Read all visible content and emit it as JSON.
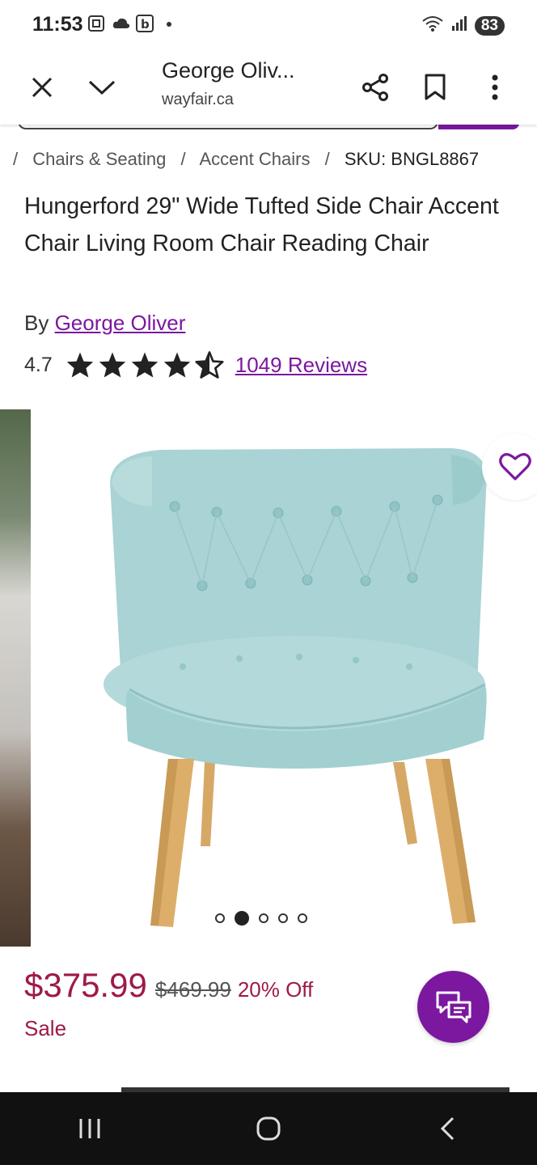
{
  "status_bar": {
    "time": "11:53",
    "battery": "83",
    "icons": [
      "screenshot-icon",
      "cloud-icon",
      "b-app-icon",
      "dot-icon",
      "wifi-icon",
      "signal-icon",
      "battery-icon"
    ]
  },
  "browser": {
    "title": "George Oliv...",
    "url": "wayfair.ca",
    "close_icon": "close-icon",
    "minimize_icon": "chevron-down-icon",
    "share_icon": "share-icon",
    "bookmark_icon": "bookmark-icon",
    "menu_icon": "more-vertical-icon"
  },
  "breadcrumb": {
    "items": [
      "Chairs & Seating",
      "Accent Chairs"
    ],
    "separator": "/",
    "sku": "SKU: BNGL8867"
  },
  "product": {
    "title": "Hungerford 29\" Wide Tufted Side Chair Accent Chair Living Room Chair Reading Chair",
    "by_prefix": "By",
    "brand": "George Oliver",
    "rating": "4.7",
    "rating_value": 4.7,
    "reviews": "1049 Reviews"
  },
  "carousel": {
    "image_alt": "Light blue tufted accent chair with wooden legs",
    "active_index": 1,
    "count": 5
  },
  "pricing": {
    "current": "$375.99",
    "original": "$469.99",
    "discount": "20% Off",
    "sale_label": "Sale"
  },
  "colors": {
    "brand_purple": "#7b189f",
    "sale_red": "#9d1a4a",
    "chair_fabric": "#a9d3d4",
    "chair_legs": "#dcae6a"
  }
}
